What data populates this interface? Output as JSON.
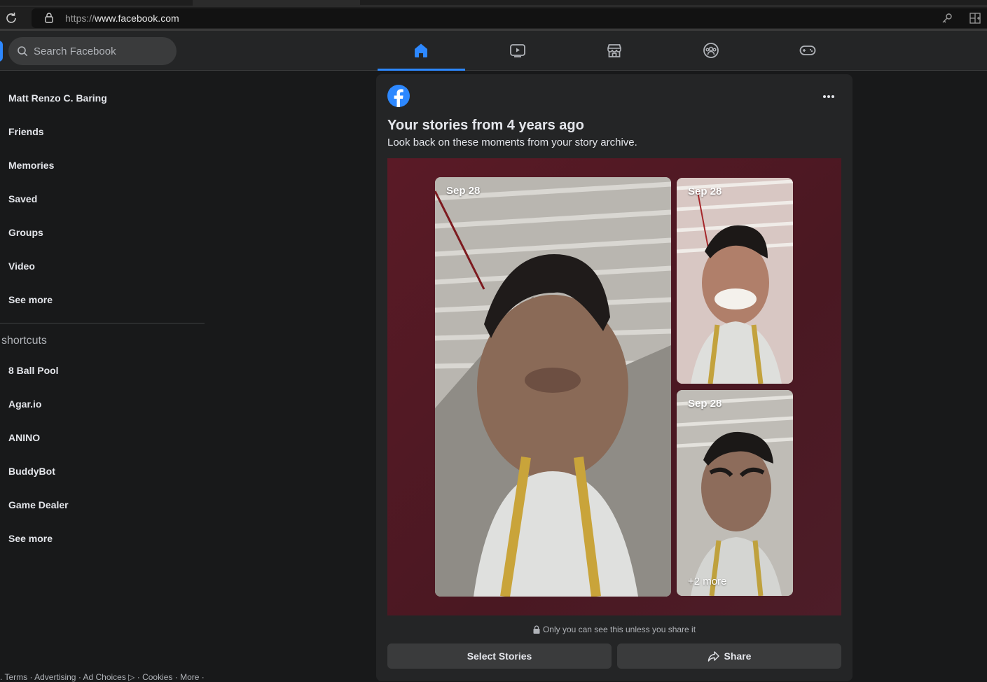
{
  "browser": {
    "url_protocol": "https://",
    "url_host": "www.facebook.com"
  },
  "header": {
    "search_placeholder": "Search Facebook",
    "nav_tabs": [
      {
        "name": "home-icon",
        "active": true
      },
      {
        "name": "watch-icon",
        "active": false
      },
      {
        "name": "marketplace-icon",
        "active": false
      },
      {
        "name": "groups-icon",
        "active": false
      },
      {
        "name": "gaming-icon",
        "active": false
      }
    ]
  },
  "sidebar": {
    "items": [
      "Matt Renzo C. Baring",
      "Friends",
      "Memories",
      "Saved",
      "Groups",
      "Video",
      "See more"
    ],
    "shortcuts_heading": "shortcuts",
    "shortcuts": [
      "8 Ball Pool",
      "Agar.io",
      "ANINO",
      "BuddyBot",
      "Game Dealer",
      "See more"
    ],
    "footer": ". Terms · Advertising · Ad Choices ▷ · Cookies · More ·"
  },
  "memory_card": {
    "title": "Your stories from 4 years ago",
    "subtitle": "Look back on these moments from your story archive.",
    "photos": [
      {
        "date": "Sep 28",
        "more": ""
      },
      {
        "date": "Sep 28",
        "more": ""
      },
      {
        "date": "Sep 28",
        "more": "+2 more"
      }
    ],
    "privacy_note": "Only you can see this unless you share it",
    "select_button": "Select Stories",
    "share_button": "Share"
  },
  "colors": {
    "accent": "#2d88ff",
    "background": "#18191a",
    "surface": "#242526",
    "stage": "#4f1b25"
  }
}
